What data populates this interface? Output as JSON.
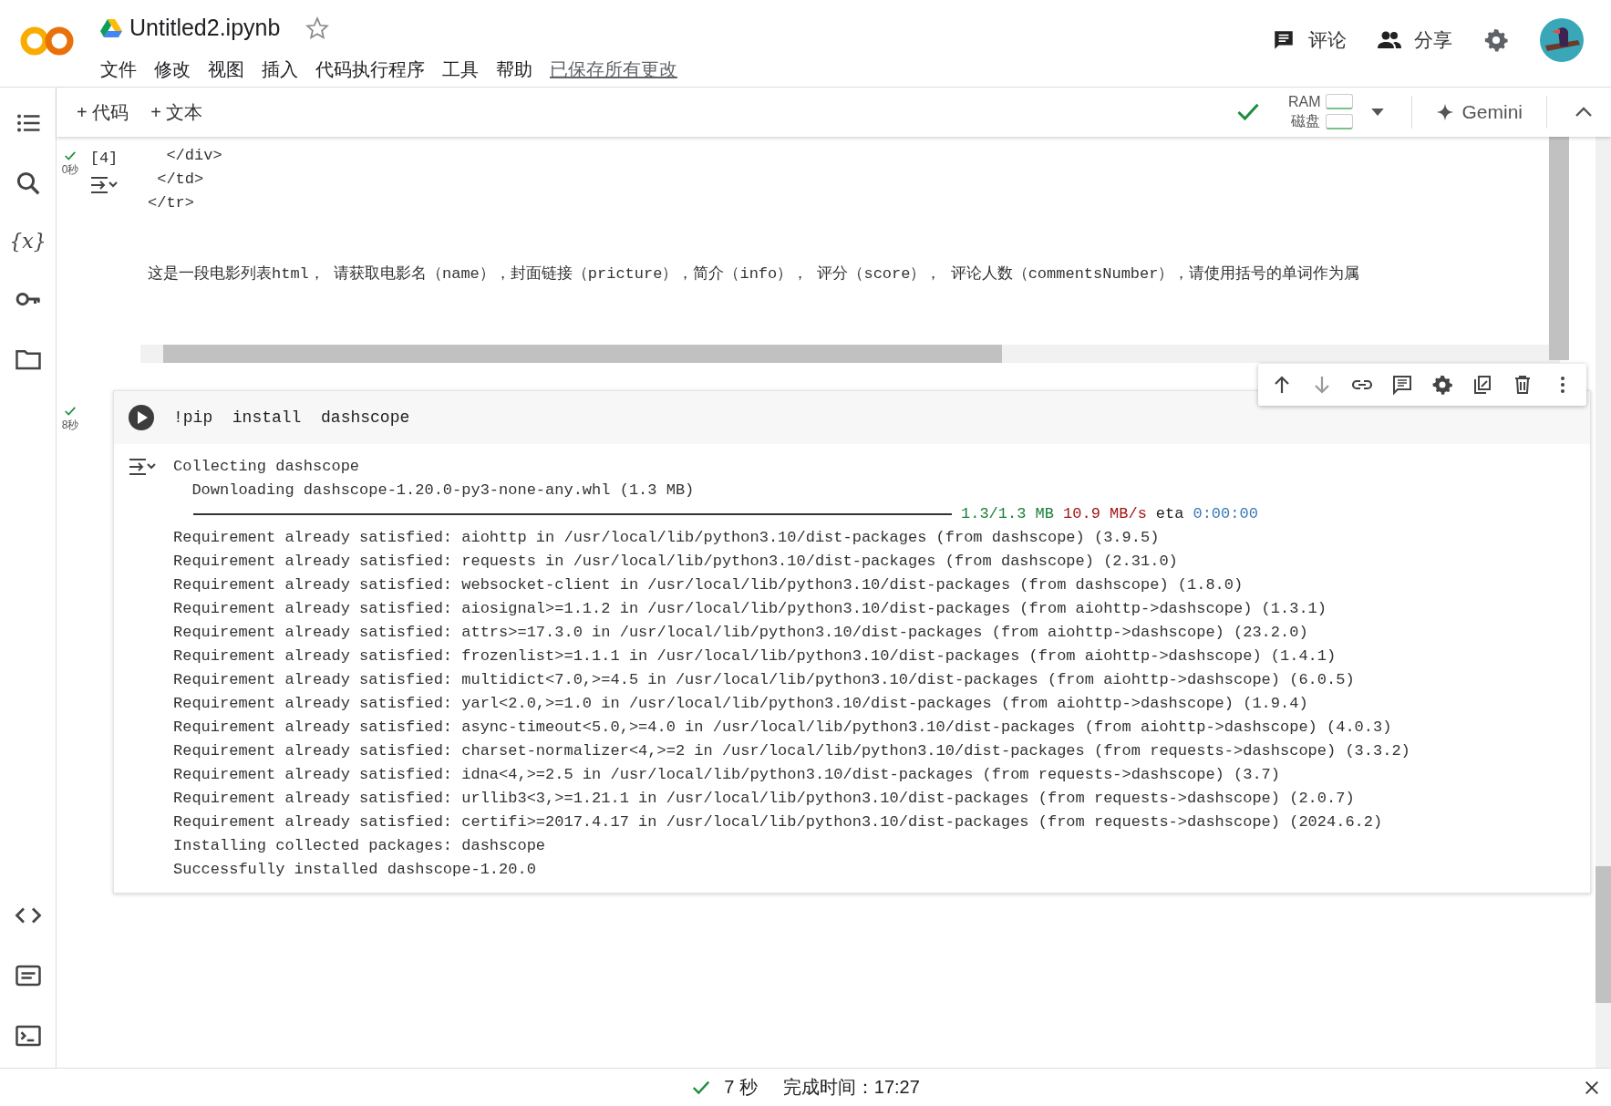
{
  "header": {
    "title": "Untitled2.ipynb",
    "menu": [
      "文件",
      "修改",
      "视图",
      "插入",
      "代码执行程序",
      "工具",
      "帮助"
    ],
    "save_status": "已保存所有更改",
    "actions": [
      {
        "kind": "comment",
        "label": "评论"
      },
      {
        "kind": "share",
        "label": "分享"
      }
    ]
  },
  "toolbar": {
    "add_buttons": [
      "+ 代码",
      "+ 文本"
    ],
    "resources": [
      "RAM",
      "磁盘"
    ],
    "gemini": "Gemini"
  },
  "sidebar": {
    "variables_label": "{x}"
  },
  "cells": [
    {
      "count": "[4]",
      "duration": "0秒",
      "output": [
        "  </div>",
        " </td>",
        "</tr>"
      ],
      "text_output": "这是一段电影列表html， 请获取电影名（name），封面链接（pricture），简介（info）， 评分（score）， 评论人数（commentsNumber），请使用括号的单词作为属"
    },
    {
      "duration": "8秒",
      "code": "!pip  install  dashscope",
      "output": [
        "Collecting dashscope",
        "  Downloading dashscope-1.20.0-py3-none-any.whl (1.3 MB)"
      ],
      "progress": {
        "segments": [
          {
            "text": "1.3/1.3 MB",
            "color": "#1a7f37"
          },
          {
            "text": "10.9 MB/s",
            "color": "#a31515"
          },
          {
            "text": "eta",
            "color": "#212121"
          },
          {
            "text": "0:00:00",
            "color": "#3a7ab8"
          }
        ]
      },
      "output_after": [
        "Requirement already satisfied: aiohttp in /usr/local/lib/python3.10/dist-packages (from dashscope) (3.9.5)",
        "Requirement already satisfied: requests in /usr/local/lib/python3.10/dist-packages (from dashscope) (2.31.0)",
        "Requirement already satisfied: websocket-client in /usr/local/lib/python3.10/dist-packages (from dashscope) (1.8.0)",
        "Requirement already satisfied: aiosignal>=1.1.2 in /usr/local/lib/python3.10/dist-packages (from aiohttp->dashscope) (1.3.1)",
        "Requirement already satisfied: attrs>=17.3.0 in /usr/local/lib/python3.10/dist-packages (from aiohttp->dashscope) (23.2.0)",
        "Requirement already satisfied: frozenlist>=1.1.1 in /usr/local/lib/python3.10/dist-packages (from aiohttp->dashscope) (1.4.1)",
        "Requirement already satisfied: multidict<7.0,>=4.5 in /usr/local/lib/python3.10/dist-packages (from aiohttp->dashscope) (6.0.5)",
        "Requirement already satisfied: yarl<2.0,>=1.0 in /usr/local/lib/python3.10/dist-packages (from aiohttp->dashscope) (1.9.4)",
        "Requirement already satisfied: async-timeout<5.0,>=4.0 in /usr/local/lib/python3.10/dist-packages (from aiohttp->dashscope) (4.0.3)",
        "Requirement already satisfied: charset-normalizer<4,>=2 in /usr/local/lib/python3.10/dist-packages (from requests->dashscope) (3.3.2)",
        "Requirement already satisfied: idna<4,>=2.5 in /usr/local/lib/python3.10/dist-packages (from requests->dashscope) (3.7)",
        "Requirement already satisfied: urllib3<3,>=1.21.1 in /usr/local/lib/python3.10/dist-packages (from requests->dashscope) (2.0.7)",
        "Requirement already satisfied: certifi>=2017.4.17 in /usr/local/lib/python3.10/dist-packages (from requests->dashscope) (2024.6.2)",
        "Installing collected packages: dashscope",
        "Successfully installed dashscope-1.20.0"
      ]
    }
  ],
  "status_bar": {
    "duration": "7 秒",
    "finish": "完成时间：17:27"
  }
}
